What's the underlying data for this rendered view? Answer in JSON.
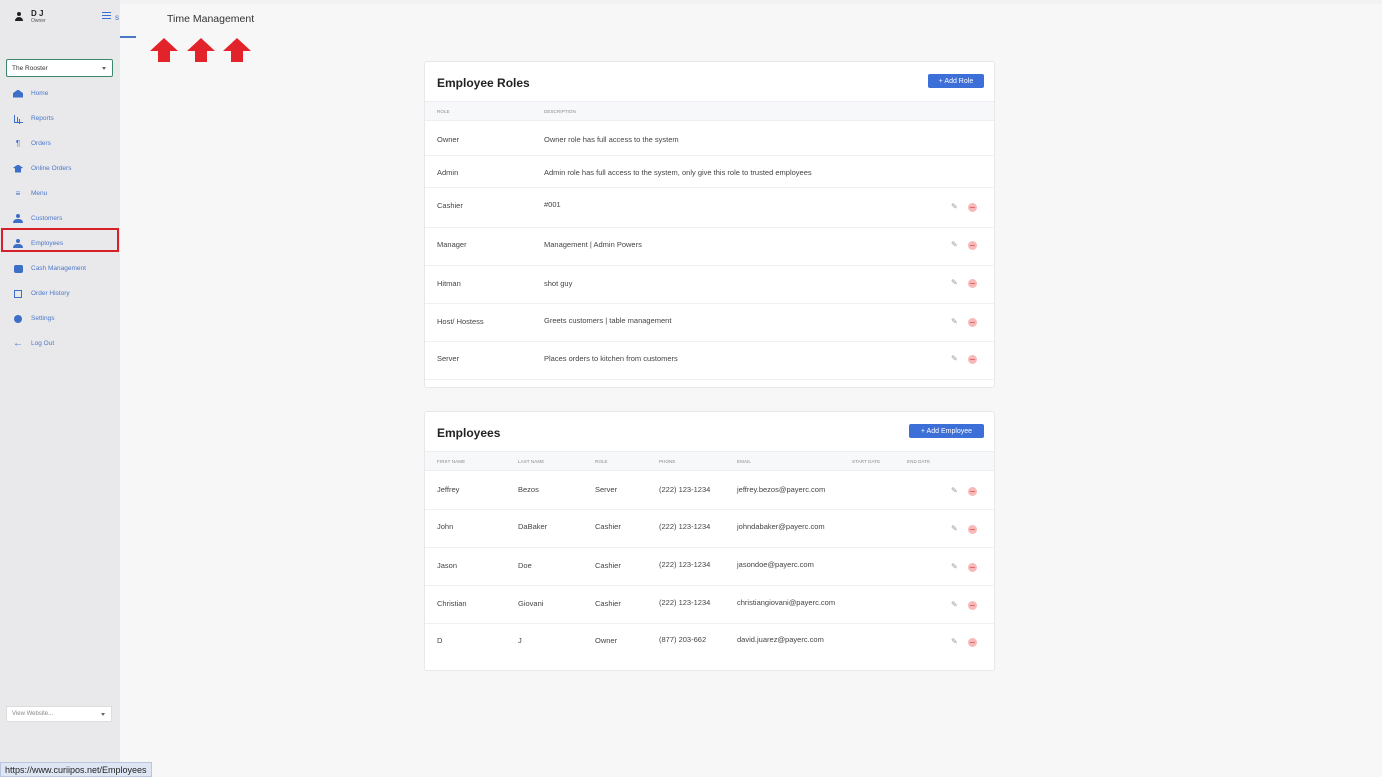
{
  "user": {
    "name": "D J",
    "role": "Owner"
  },
  "store_select": {
    "value": "The Rooster"
  },
  "nav": [
    {
      "label": "Home",
      "icon": "home-icon"
    },
    {
      "label": "Reports",
      "icon": "bar-chart-icon"
    },
    {
      "label": "Orders",
      "icon": "orders-icon"
    },
    {
      "label": "Online Orders",
      "icon": "graduation-cap-icon"
    },
    {
      "label": "Menu",
      "icon": "menu-icon"
    },
    {
      "label": "Customers",
      "icon": "customers-icon"
    },
    {
      "label": "Employees",
      "icon": "employee-icon"
    },
    {
      "label": "Cash Management",
      "icon": "cash-icon"
    },
    {
      "label": "Order History",
      "icon": "history-icon"
    },
    {
      "label": "Settings",
      "icon": "gear-icon"
    },
    {
      "label": "Log Out",
      "icon": "arrow-left-icon"
    }
  ],
  "website_select": {
    "value": "View Website..."
  },
  "status_url": "https://www.curiipos.net/Employees",
  "tabs": {
    "employees_partial": "s",
    "time_management": "Time Management"
  },
  "roles_card": {
    "title": "Employee Roles",
    "add_label": "+ Add Role",
    "headers": [
      "Role",
      "Description"
    ],
    "rows": [
      {
        "role": "Owner",
        "description": "Owner role has full access to the system"
      },
      {
        "role": "Admin",
        "description": "Admin role has full access to the system, only give this role to trusted employees"
      },
      {
        "role": "Cashier",
        "description": "#001"
      },
      {
        "role": "Manager",
        "description": "Management | Admin Powers"
      },
      {
        "role": "Hitman",
        "description": "shot guy"
      },
      {
        "role": "Host/ Hostess",
        "description": "Greets customers | table management"
      },
      {
        "role": "Server",
        "description": "Places orders to kitchen from customers"
      }
    ]
  },
  "employees_card": {
    "title": "Employees",
    "add_label": "+ Add Employee",
    "headers": [
      "First Name",
      "Last Name",
      "Role",
      "Phone",
      "Email",
      "Start Date",
      "End Date"
    ],
    "rows": [
      {
        "first": "Jeffrey",
        "last": "Bezos",
        "role": "Server",
        "phone": "(222) 123-1234",
        "email": "jeffrey.bezos@payerc.com"
      },
      {
        "first": "John",
        "last": "DaBaker",
        "role": "Cashier",
        "phone": "(222) 123-1234",
        "email": "johndabaker@payerc.com"
      },
      {
        "first": "Jason",
        "last": "Doe",
        "role": "Cashier",
        "phone": "(222) 123-1234",
        "email": "jasondoe@payerc.com"
      },
      {
        "first": "Christian",
        "last": "Giovani",
        "role": "Cashier",
        "phone": "(222) 123-1234",
        "email": "christiangiovani@payerc.com"
      },
      {
        "first": "D",
        "last": "J",
        "role": "Owner",
        "phone": "(877) 203-662",
        "email": "david.juarez@payerc.com"
      }
    ]
  },
  "colors": {
    "accent": "#3d6fd9",
    "highlight": "#d6202a",
    "delete": "#f6b9b9"
  }
}
